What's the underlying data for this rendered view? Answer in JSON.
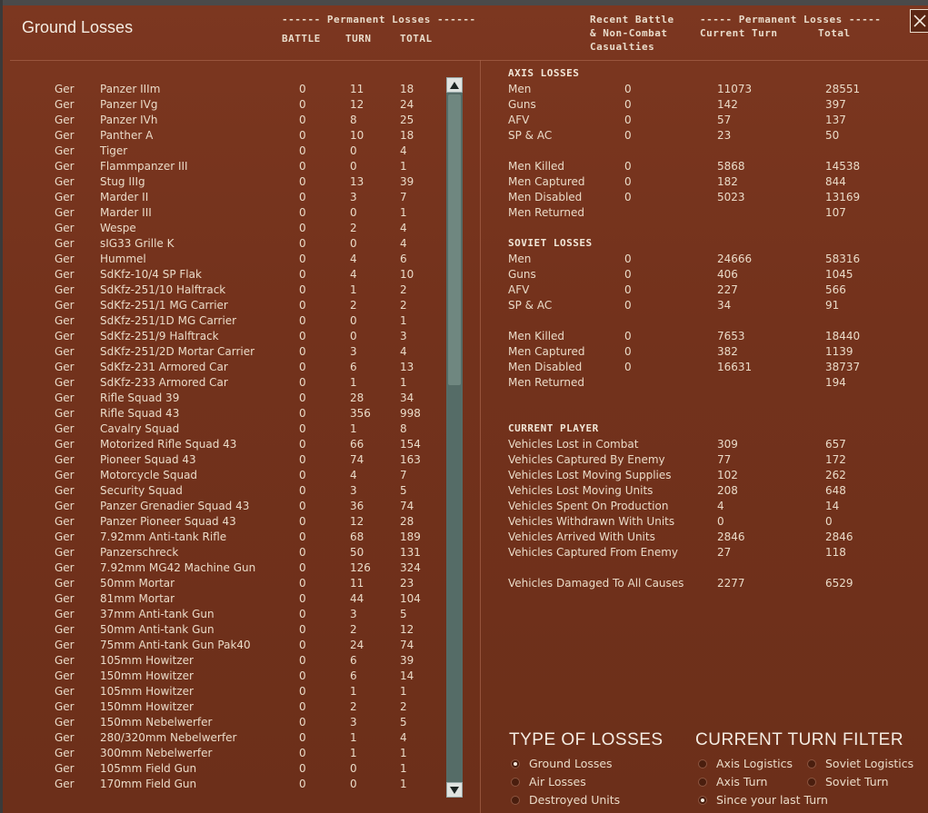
{
  "window": {
    "title": "Ground Losses"
  },
  "headers": {
    "perm_losses_left": "------ Permanent Losses ------",
    "battle": "BATTLE",
    "turn": "TURN",
    "total": "TOTAL",
    "recent_line1": "Recent Battle",
    "recent_line2": "& Non-Combat",
    "recent_line3": "Casualties",
    "perm_losses_right": "----- Permanent Losses -----",
    "current_turn": "Current Turn",
    "right_total": "Total"
  },
  "units": [
    {
      "nation": "Ger",
      "name": "Panzer IIIm",
      "battle": "0",
      "turn": "11",
      "total": "18"
    },
    {
      "nation": "Ger",
      "name": "Panzer IVg",
      "battle": "0",
      "turn": "12",
      "total": "24"
    },
    {
      "nation": "Ger",
      "name": "Panzer IVh",
      "battle": "0",
      "turn": "8",
      "total": "25"
    },
    {
      "nation": "Ger",
      "name": "Panther A",
      "battle": "0",
      "turn": "10",
      "total": "18"
    },
    {
      "nation": "Ger",
      "name": "Tiger",
      "battle": "0",
      "turn": "0",
      "total": "4"
    },
    {
      "nation": "Ger",
      "name": "Flammpanzer III",
      "battle": "0",
      "turn": "0",
      "total": "1"
    },
    {
      "nation": "Ger",
      "name": "Stug IIIg",
      "battle": "0",
      "turn": "13",
      "total": "39"
    },
    {
      "nation": "Ger",
      "name": "Marder II",
      "battle": "0",
      "turn": "3",
      "total": "7"
    },
    {
      "nation": "Ger",
      "name": "Marder III",
      "battle": "0",
      "turn": "0",
      "total": "1"
    },
    {
      "nation": "Ger",
      "name": "Wespe",
      "battle": "0",
      "turn": "2",
      "total": "4"
    },
    {
      "nation": "Ger",
      "name": "sIG33 Grille K",
      "battle": "0",
      "turn": "0",
      "total": "4"
    },
    {
      "nation": "Ger",
      "name": "Hummel",
      "battle": "0",
      "turn": "4",
      "total": "6"
    },
    {
      "nation": "Ger",
      "name": "SdKfz-10/4 SP Flak",
      "battle": "0",
      "turn": "4",
      "total": "10"
    },
    {
      "nation": "Ger",
      "name": "SdKfz-251/10 Halftrack",
      "battle": "0",
      "turn": "1",
      "total": "2"
    },
    {
      "nation": "Ger",
      "name": "SdKfz-251/1 MG Carrier",
      "battle": "0",
      "turn": "2",
      "total": "2"
    },
    {
      "nation": "Ger",
      "name": "SdKfz-251/1D MG Carrier",
      "battle": "0",
      "turn": "0",
      "total": "1"
    },
    {
      "nation": "Ger",
      "name": "SdKfz-251/9 Halftrack",
      "battle": "0",
      "turn": "0",
      "total": "3"
    },
    {
      "nation": "Ger",
      "name": "SdKfz-251/2D Mortar Carrier",
      "battle": "0",
      "turn": "3",
      "total": "4"
    },
    {
      "nation": "Ger",
      "name": "SdKfz-231 Armored Car",
      "battle": "0",
      "turn": "6",
      "total": "13"
    },
    {
      "nation": "Ger",
      "name": "SdKfz-233 Armored Car",
      "battle": "0",
      "turn": "1",
      "total": "1"
    },
    {
      "nation": "Ger",
      "name": "Rifle Squad 39",
      "battle": "0",
      "turn": "28",
      "total": "34"
    },
    {
      "nation": "Ger",
      "name": "Rifle Squad 43",
      "battle": "0",
      "turn": "356",
      "total": "998"
    },
    {
      "nation": "Ger",
      "name": "Cavalry Squad",
      "battle": "0",
      "turn": "1",
      "total": "8"
    },
    {
      "nation": "Ger",
      "name": "Motorized Rifle Squad 43",
      "battle": "0",
      "turn": "66",
      "total": "154"
    },
    {
      "nation": "Ger",
      "name": "Pioneer Squad 43",
      "battle": "0",
      "turn": "74",
      "total": "163"
    },
    {
      "nation": "Ger",
      "name": "Motorcycle Squad",
      "battle": "0",
      "turn": "4",
      "total": "7"
    },
    {
      "nation": "Ger",
      "name": "Security Squad",
      "battle": "0",
      "turn": "3",
      "total": "5"
    },
    {
      "nation": "Ger",
      "name": "Panzer Grenadier Squad 43",
      "battle": "0",
      "turn": "36",
      "total": "74"
    },
    {
      "nation": "Ger",
      "name": "Panzer Pioneer Squad 43",
      "battle": "0",
      "turn": "12",
      "total": "28"
    },
    {
      "nation": "Ger",
      "name": "7.92mm Anti-tank Rifle",
      "battle": "0",
      "turn": "68",
      "total": "189"
    },
    {
      "nation": "Ger",
      "name": "Panzerschreck",
      "battle": "0",
      "turn": "50",
      "total": "131"
    },
    {
      "nation": "Ger",
      "name": "7.92mm MG42 Machine Gun",
      "battle": "0",
      "turn": "126",
      "total": "324"
    },
    {
      "nation": "Ger",
      "name": "50mm Mortar",
      "battle": "0",
      "turn": "11",
      "total": "23"
    },
    {
      "nation": "Ger",
      "name": "81mm Mortar",
      "battle": "0",
      "turn": "44",
      "total": "104"
    },
    {
      "nation": "Ger",
      "name": "37mm Anti-tank Gun",
      "battle": "0",
      "turn": "3",
      "total": "5"
    },
    {
      "nation": "Ger",
      "name": "50mm Anti-tank Gun",
      "battle": "0",
      "turn": "2",
      "total": "12"
    },
    {
      "nation": "Ger",
      "name": "75mm Anti-tank Gun Pak40",
      "battle": "0",
      "turn": "24",
      "total": "74"
    },
    {
      "nation": "Ger",
      "name": "105mm Howitzer",
      "battle": "0",
      "turn": "6",
      "total": "39"
    },
    {
      "nation": "Ger",
      "name": "150mm Howitzer",
      "battle": "0",
      "turn": "6",
      "total": "14"
    },
    {
      "nation": "Ger",
      "name": "105mm Howitzer",
      "battle": "0",
      "turn": "1",
      "total": "1"
    },
    {
      "nation": "Ger",
      "name": "150mm Howitzer",
      "battle": "0",
      "turn": "2",
      "total": "2"
    },
    {
      "nation": "Ger",
      "name": "150mm Nebelwerfer",
      "battle": "0",
      "turn": "3",
      "total": "5"
    },
    {
      "nation": "Ger",
      "name": "280/320mm Nebelwerfer",
      "battle": "0",
      "turn": "1",
      "total": "4"
    },
    {
      "nation": "Ger",
      "name": "300mm Nebelwerfer",
      "battle": "0",
      "turn": "1",
      "total": "1"
    },
    {
      "nation": "Ger",
      "name": "105mm Field Gun",
      "battle": "0",
      "turn": "0",
      "total": "1"
    },
    {
      "nation": "Ger",
      "name": "170mm Field Gun",
      "battle": "0",
      "turn": "0",
      "total": "1"
    }
  ],
  "axis": {
    "title": "AXIS LOSSES",
    "rows": [
      {
        "label": "Men",
        "recent": "0",
        "current": "11073",
        "total": "28551"
      },
      {
        "label": "Guns",
        "recent": "0",
        "current": "142",
        "total": "397"
      },
      {
        "label": "AFV",
        "recent": "0",
        "current": "57",
        "total": "137"
      },
      {
        "label": "SP & AC",
        "recent": "0",
        "current": "23",
        "total": "50"
      }
    ],
    "rows2": [
      {
        "label": "Men Killed",
        "recent": "0",
        "current": "5868",
        "total": "14538"
      },
      {
        "label": "Men Captured",
        "recent": "0",
        "current": "182",
        "total": "844"
      },
      {
        "label": "Men Disabled",
        "recent": "0",
        "current": "5023",
        "total": "13169"
      },
      {
        "label": "Men Returned",
        "recent": "",
        "current": "",
        "total": "107"
      }
    ]
  },
  "soviet": {
    "title": "SOVIET LOSSES",
    "rows": [
      {
        "label": "Men",
        "recent": "0",
        "current": "24666",
        "total": "58316"
      },
      {
        "label": "Guns",
        "recent": "0",
        "current": "406",
        "total": "1045"
      },
      {
        "label": "AFV",
        "recent": "0",
        "current": "227",
        "total": "566"
      },
      {
        "label": "SP & AC",
        "recent": "0",
        "current": "34",
        "total": "91"
      }
    ],
    "rows2": [
      {
        "label": "Men Killed",
        "recent": "0",
        "current": "7653",
        "total": "18440"
      },
      {
        "label": "Men Captured",
        "recent": "0",
        "current": "382",
        "total": "1139"
      },
      {
        "label": "Men Disabled",
        "recent": "0",
        "current": "16631",
        "total": "38737"
      },
      {
        "label": "Men Returned",
        "recent": "",
        "current": "",
        "total": "194"
      }
    ]
  },
  "player": {
    "title": "CURRENT PLAYER",
    "rows": [
      {
        "label": "Vehicles Lost in Combat",
        "recent": "",
        "current": "309",
        "total": "657"
      },
      {
        "label": "Vehicles Captured By Enemy",
        "recent": "",
        "current": "77",
        "total": "172"
      },
      {
        "label": "Vehicles Lost Moving Supplies",
        "recent": "",
        "current": "102",
        "total": "262"
      },
      {
        "label": "Vehicles Lost Moving Units",
        "recent": "",
        "current": "208",
        "total": "648"
      },
      {
        "label": "Vehicles Spent On Production",
        "recent": "",
        "current": "4",
        "total": "14"
      },
      {
        "label": "Vehicles Withdrawn With Units",
        "recent": "",
        "current": "0",
        "total": "0"
      },
      {
        "label": "Vehicles Arrived With Units",
        "recent": "",
        "current": "2846",
        "total": "2846"
      },
      {
        "label": "Vehicles Captured From Enemy",
        "recent": "",
        "current": "27",
        "total": "118"
      }
    ],
    "damaged": {
      "label": "Vehicles Damaged To All Causes",
      "recent": "",
      "current": "2277",
      "total": "6529"
    }
  },
  "type_of_losses": {
    "title": "TYPE OF LOSSES",
    "options": [
      {
        "label": "Ground Losses",
        "selected": true
      },
      {
        "label": "Air Losses",
        "selected": false
      },
      {
        "label": "Destroyed Units",
        "selected": false
      }
    ]
  },
  "turn_filter": {
    "title": "CURRENT TURN FILTER",
    "options": [
      {
        "label": "Axis Logistics",
        "selected": false
      },
      {
        "label": "Soviet Logistics",
        "selected": false
      },
      {
        "label": "Axis Turn",
        "selected": false
      },
      {
        "label": "Soviet Turn",
        "selected": false
      },
      {
        "label": "Since your last Turn",
        "selected": true
      }
    ]
  },
  "colors": {
    "background": "#6e2e18",
    "text": "#eadbc8",
    "scrollbar": "#556c67"
  }
}
